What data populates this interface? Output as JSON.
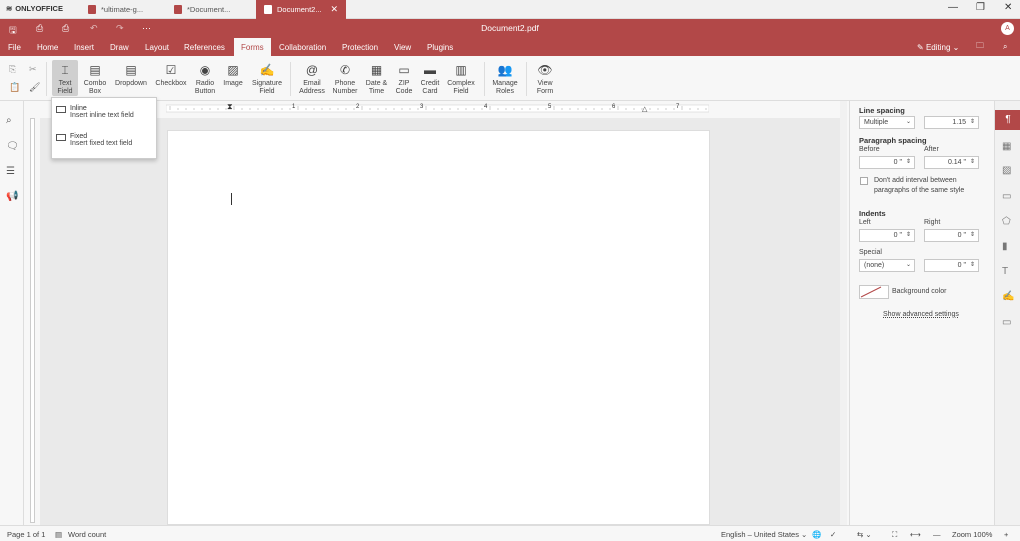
{
  "app": {
    "brand": "ONLYOFFICE"
  },
  "tabs": [
    {
      "label": "*ultimate-g..."
    },
    {
      "label": "*Document..."
    },
    {
      "label": "Document2..."
    }
  ],
  "header": {
    "title": "Document2.pdf",
    "avatar": "A",
    "mode": "Editing"
  },
  "menu": [
    "File",
    "Home",
    "Insert",
    "Draw",
    "Layout",
    "References",
    "Forms",
    "Collaboration",
    "Protection",
    "View",
    "Plugins"
  ],
  "toolbar": {
    "text_field": "Text Field",
    "combo_box": "Combo Box",
    "dropdown": "Dropdown",
    "checkbox": "Checkbox",
    "radio_button": "Radio Button",
    "image": "Image",
    "signature_field": "Signature Field",
    "email_address": "Email Address",
    "phone_number": "Phone Number",
    "date_time": "Date & Time",
    "zip_code": "ZIP Code",
    "credit_card": "Credit Card",
    "complex_field": "Complex Field",
    "manage_roles": "Manage Roles",
    "view_form": "View Form"
  },
  "dropdown_menu": [
    {
      "title": "Inline",
      "desc": "Insert inline text field"
    },
    {
      "title": "Fixed",
      "desc": "Insert fixed text field"
    }
  ],
  "ruler": {
    "labels": [
      "1",
      "2",
      "3",
      "4",
      "5",
      "6",
      "7"
    ]
  },
  "panel": {
    "line_spacing": "Line spacing",
    "line_mode": "Multiple",
    "line_value": "1.15",
    "para_spacing": "Paragraph spacing",
    "before_label": "Before",
    "before_value": "0 \"",
    "after_label": "After",
    "after_value": "0.14 \"",
    "dont_add": "Don't add interval between",
    "dont_add2": "paragraphs of the same style",
    "indents": "Indents",
    "left_label": "Left",
    "left_value": "0 \"",
    "right_label": "Right",
    "right_value": "0 \"",
    "special_label": "Special",
    "special_value": "(none)",
    "special_amount": "0 \"",
    "bg_color": "Background color",
    "advanced": "Show advanced settings"
  },
  "status": {
    "page": "Page 1 of 1",
    "word_count": "Word count",
    "language": "English – United States",
    "zoom": "Zoom 100%"
  },
  "colors": {
    "accent": "#b24848"
  }
}
